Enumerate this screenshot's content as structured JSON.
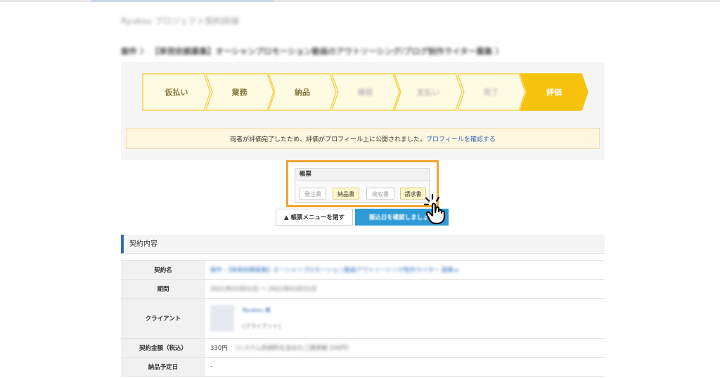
{
  "site": {
    "title": "Ryukou プロジェクト契約詳細"
  },
  "breadcrumb": {
    "text": "案件 〉 【単発依頼募集】オーシャンプロモーション動画のアウトソーシング/ブログ制作ライター募集 〉"
  },
  "progress": {
    "steps": [
      {
        "label": "仮払い",
        "state": "done"
      },
      {
        "label": "業務",
        "state": "done"
      },
      {
        "label": "納品",
        "state": "done"
      },
      {
        "label": "検収",
        "state": "dim"
      },
      {
        "label": "支払い",
        "state": "dim"
      },
      {
        "label": "完了",
        "state": "dim"
      },
      {
        "label": "評価",
        "state": "active"
      }
    ],
    "colors": {
      "step_bg": "#fffbe3",
      "step_border": "#f5d24a",
      "active_bg": "#f6c20c"
    }
  },
  "notice": {
    "text": "両者が評価完了したため、評価がプロフィール上に公開されました。",
    "link_label": "プロフィールを確認する"
  },
  "documents": {
    "header": "帳票",
    "buttons": [
      {
        "label": "発注書",
        "enabled": false
      },
      {
        "label": "納品書",
        "enabled": true
      },
      {
        "label": "検収書",
        "enabled": false
      },
      {
        "label": "請求書",
        "enabled": true
      }
    ],
    "highlight_color": "#f2a331"
  },
  "actions": {
    "close_menu_label": "▲ 帳票メニューを閉す",
    "confirm_label": "振込日を確認しましょう"
  },
  "contract": {
    "section_title": "契約内容",
    "rows": [
      {
        "label": "契約名",
        "value": "案件・【単発依頼募集】オーシャンプロモーション動画アウトソーシング制作ライター 募集 ▸"
      },
      {
        "label": "期間",
        "value": "2021年03月01日 〜 2021年03月31日"
      },
      {
        "label": "クライアント",
        "client_name": "Ryukou 様",
        "client_sub": "[クライアント]"
      },
      {
        "label": "契約金額（税込）",
        "value_prefix": "330円",
        "value_rest": "（システム利用料を含めたご請求額 330円）"
      },
      {
        "label": "納品予定日",
        "value": "-"
      }
    ]
  }
}
